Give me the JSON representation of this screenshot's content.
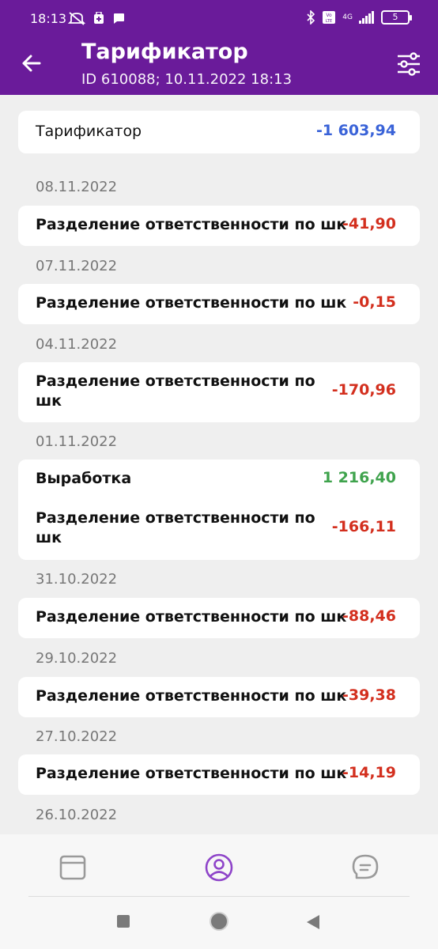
{
  "status_bar": {
    "time": "18:13",
    "battery": "5",
    "network": "4G"
  },
  "header": {
    "title": "Тарификатор",
    "subtitle": "ID 610088; 10.11.2022 18:13"
  },
  "summary": {
    "label": "Тарификатор",
    "value": "-1 603,94"
  },
  "groups": [
    {
      "date": "08.11.2022",
      "items": [
        {
          "label": "Разделение ответственности по шк",
          "value": "-41,90"
        }
      ]
    },
    {
      "date": "07.11.2022",
      "items": [
        {
          "label": "Разделение ответственности по шк",
          "value": "-0,15"
        }
      ]
    },
    {
      "date": "04.11.2022",
      "items": [
        {
          "label": "Разделение ответственности по шк",
          "value": "-170,96"
        }
      ]
    },
    {
      "date": "01.11.2022",
      "items": [
        {
          "label": "Выработка",
          "value": "1 216,40"
        },
        {
          "label": "Разделение ответственности по шк",
          "value": "-166,11"
        }
      ]
    },
    {
      "date": "31.10.2022",
      "items": [
        {
          "label": "Разделение ответственности по шк",
          "value": "-88,46"
        }
      ]
    },
    {
      "date": "29.10.2022",
      "items": [
        {
          "label": "Разделение ответственности по шк",
          "value": "-39,38"
        }
      ]
    },
    {
      "date": "27.10.2022",
      "items": [
        {
          "label": "Разделение ответственности по шк",
          "value": "-14,19"
        }
      ]
    },
    {
      "date": "26.10.2022",
      "items": []
    }
  ],
  "colors": {
    "brand": "#6a1b9a",
    "negative": "#d32f1e",
    "positive": "#3fa34d",
    "summary": "#3a63d8",
    "nav_active": "#8e44c9"
  },
  "bottom_nav": {
    "items": [
      {
        "icon": "wallet-icon",
        "active": false
      },
      {
        "icon": "profile-icon",
        "active": true
      },
      {
        "icon": "chat-icon",
        "active": false
      }
    ]
  }
}
